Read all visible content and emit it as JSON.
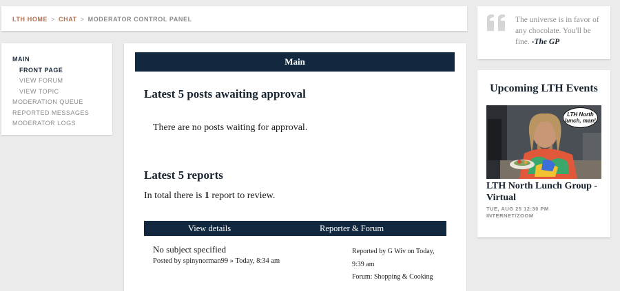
{
  "breadcrumb": {
    "items": [
      "LTH HOME",
      "CHAT"
    ],
    "separator": ">",
    "current": "MODERATOR CONTROL PANEL"
  },
  "nav": {
    "items": [
      {
        "label": "MAIN",
        "state": "active"
      },
      {
        "label": "FRONT PAGE",
        "state": "active-sub"
      },
      {
        "label": "VIEW FORUM",
        "state": "sub"
      },
      {
        "label": "VIEW TOPIC",
        "state": "sub"
      },
      {
        "label": "MODERATION QUEUE",
        "state": "normal"
      },
      {
        "label": "REPORTED MESSAGES",
        "state": "normal"
      },
      {
        "label": "MODERATOR LOGS",
        "state": "normal"
      }
    ]
  },
  "main": {
    "bar_title": "Main",
    "posts_heading": "Latest 5 posts awaiting approval",
    "posts_empty": "There are no posts waiting for approval.",
    "reports_heading": "Latest 5 reports",
    "reports_total_pre": "In total there is",
    "reports_total_count": "1",
    "reports_total_post": "report to review.",
    "table": {
      "col_details": "View details",
      "col_reporter": "Reporter & Forum",
      "row": {
        "subject": "No subject specified",
        "posted_prefix": "Posted by",
        "posted_user": "spinynorman99",
        "posted_sep": "»",
        "posted_time": "Today, 8:34 am",
        "reported_by": "Reported by G Wiv",
        "reported_on": "on Today,",
        "reported_time": "9:39 am",
        "forum_label": "Forum:",
        "forum_name": "Shopping & Cooking"
      }
    }
  },
  "quote": {
    "text": "The universe is in favor of any chocolate. You'll be fine.",
    "author": "-The GP"
  },
  "events": {
    "title": "Upcoming LTH Events",
    "image_caption": "LTH North lunch, man!",
    "event_name": "LTH North Lunch Group - Virtual",
    "datetime": "TUE, AUG 25 12:30 PM",
    "location": "INTERNET/ZOOM"
  },
  "colors": {
    "navy": "#12283e",
    "breadcrumb_link": "#b1704f",
    "muted": "#8a8a8a",
    "background": "#ebebeb"
  }
}
